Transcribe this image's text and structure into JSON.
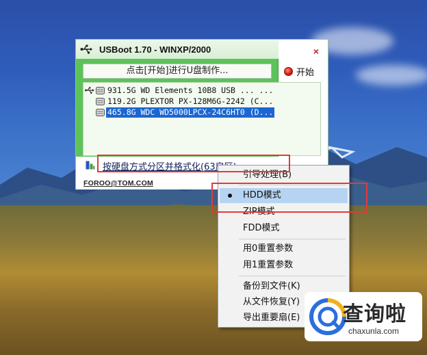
{
  "window": {
    "title": "USBoot 1.70 - WINXP/2000",
    "close_label": "×",
    "status_text": "点击[开始]进行U盘制作...",
    "start_label": "开始",
    "drives": [
      {
        "text": "931.5G  WD Elements 10B8 USB ... ..."
      },
      {
        "text": "119.2G  PLEXTOR PX-128M6G-2242 (C..."
      },
      {
        "text": "465.8G  WDC WD5000LPCX-24C6HT0 (D..."
      }
    ],
    "format_mode": "按硬盘方式分区并格式化(63扇区)",
    "email": "FOROO@TOM.COM"
  },
  "menu": {
    "items": [
      {
        "label": "引导处理(B)"
      },
      {
        "label": "HDD模式",
        "checked": true
      },
      {
        "label": "ZIP模式"
      },
      {
        "label": "FDD模式"
      },
      {
        "label": "用0重置参数"
      },
      {
        "label": "用1重置参数"
      },
      {
        "label": "备份到文件(K)"
      },
      {
        "label": "从文件恢复(Y)"
      },
      {
        "label": "导出重要扇(E)"
      }
    ]
  },
  "watermark": {
    "brand": "查询啦",
    "url": "chaxunla.com"
  },
  "colors": {
    "panel_green": "#5ec25a",
    "selection_blue": "#1b66d1",
    "menu_highlight": "#b6d4f2",
    "highlight_red": "#e23a3a"
  }
}
